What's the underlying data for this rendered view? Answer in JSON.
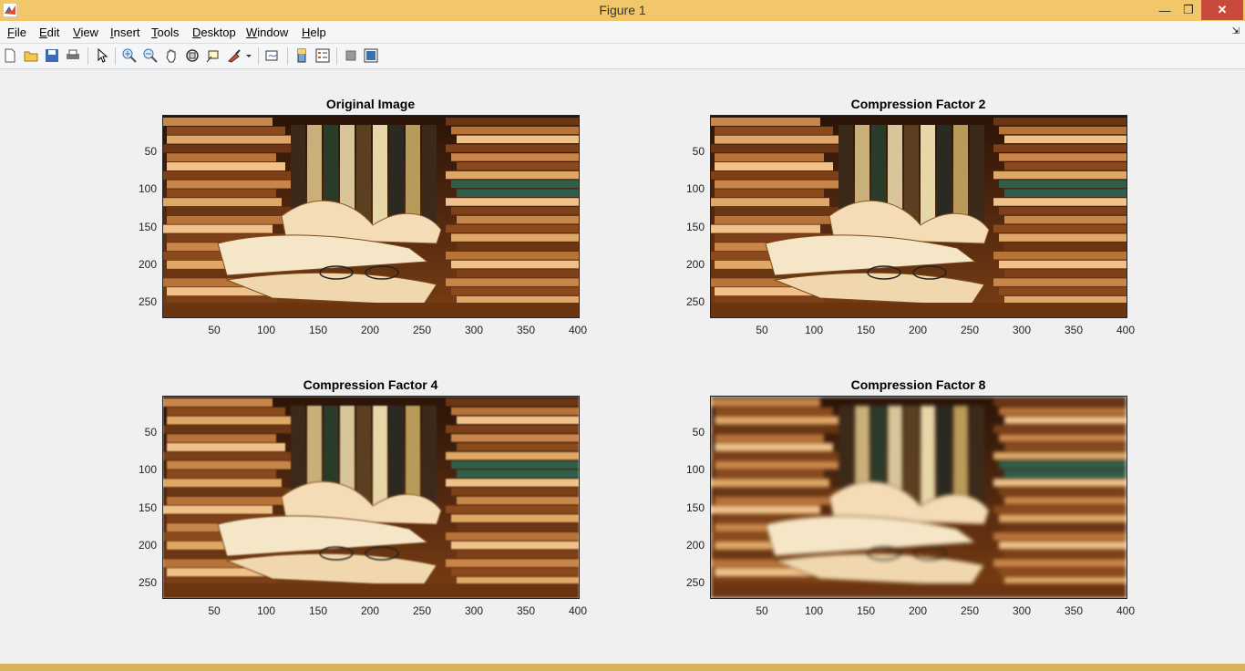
{
  "window": {
    "title": "Figure 1",
    "minimize": "—",
    "maximize": "❐",
    "close": "✕"
  },
  "menu": [
    {
      "label": "File"
    },
    {
      "label": "Edit"
    },
    {
      "label": "View"
    },
    {
      "label": "Insert"
    },
    {
      "label": "Tools"
    },
    {
      "label": "Desktop"
    },
    {
      "label": "Window"
    },
    {
      "label": "Help"
    }
  ],
  "toolbar": [
    "new-figure-icon",
    "open-file-icon",
    "save-icon",
    "print-icon",
    "edit-plot-icon",
    "zoom-in-icon",
    "zoom-out-icon",
    "pan-icon",
    "rotate-3d-icon",
    "data-cursor-icon",
    "brush-icon",
    "link-plot-icon",
    "insert-colorbar-icon",
    "insert-legend-icon",
    "hide-plot-tools-icon",
    "show-plot-tools-icon"
  ],
  "plots": [
    {
      "title": "Original Image",
      "blur": 0
    },
    {
      "title": "Compression Factor 2",
      "blur": 0.3
    },
    {
      "title": "Compression Factor 4",
      "blur": 0.9
    },
    {
      "title": "Compression Factor 8",
      "blur": 2.2
    }
  ],
  "axes": {
    "yticks": [
      "50",
      "100",
      "150",
      "200",
      "250"
    ],
    "xticks": [
      "50",
      "100",
      "150",
      "200",
      "250",
      "300",
      "350",
      "400"
    ]
  },
  "colors": {
    "titlebar": "#f2c76a",
    "close": "#c74a3c"
  }
}
